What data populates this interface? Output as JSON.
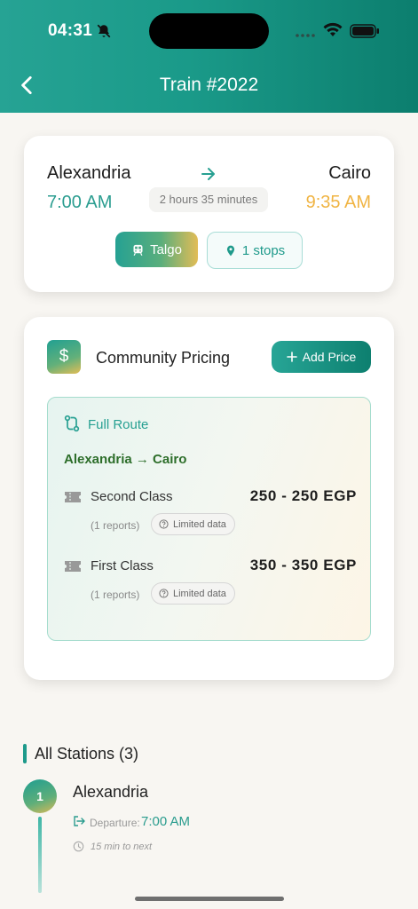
{
  "status_bar": {
    "time": "04:31"
  },
  "header": {
    "title": "Train #2022"
  },
  "route": {
    "from": "Alexandria",
    "to": "Cairo",
    "departure": "7:00 AM",
    "arrival": "9:35 AM",
    "duration": "2 hours 35 minutes",
    "train_type": "Talgo",
    "stops": "1 stops"
  },
  "pricing": {
    "title": "Community Pricing",
    "add_button": "Add Price",
    "currency_symbol": "$",
    "route_label": "Full Route",
    "od": "Alexandria → Cairo",
    "classes": [
      {
        "name": "Second Class",
        "price": "250 - 250 EGP",
        "reports": "(1 reports)",
        "badge": "Limited data"
      },
      {
        "name": "First Class",
        "price": "350 - 350 EGP",
        "reports": "(1 reports)",
        "badge": "Limited data"
      }
    ]
  },
  "stations": {
    "title": "All Stations (3)",
    "items": [
      {
        "number": "1",
        "name": "Alexandria",
        "departure_label": "Departure:",
        "departure_time": "7:00 AM",
        "next": "15 min to next"
      }
    ]
  },
  "colors": {
    "primary": "#1e9a8b",
    "accent": "#f0b443",
    "header_dark": "#0c7e6e"
  }
}
